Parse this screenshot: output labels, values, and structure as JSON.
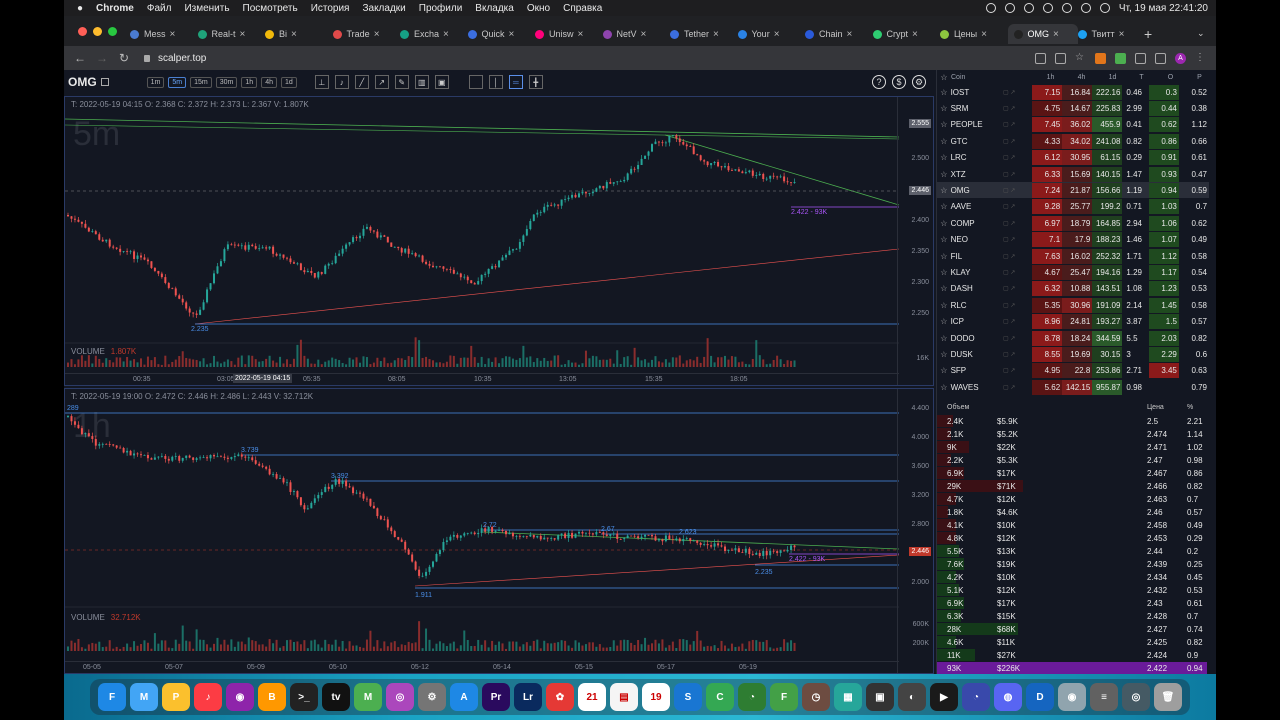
{
  "menubar": {
    "app": "Chrome",
    "items": [
      "Файл",
      "Изменить",
      "Посмотреть",
      "История",
      "Закладки",
      "Профили",
      "Вкладка",
      "Окно",
      "Справка"
    ],
    "clock": "Чт, 19 мая  22:41:20"
  },
  "tabs": [
    {
      "label": "Mess",
      "color": "#4a7bd0"
    },
    {
      "label": "Real-t",
      "color": "#1fa37a"
    },
    {
      "label": "Bi",
      "color": "#f0b90b"
    },
    {
      "label": "Trade",
      "color": "#e04a4a"
    },
    {
      "label": "Excha",
      "color": "#16a085"
    },
    {
      "label": "Quick",
      "color": "#3b6ee0"
    },
    {
      "label": "Unisw",
      "color": "#ff007a"
    },
    {
      "label": "NetV",
      "color": "#8e44ad"
    },
    {
      "label": "Tether",
      "color": "#3b6ee0"
    },
    {
      "label": "Your",
      "color": "#2a82e4"
    },
    {
      "label": "Chain",
      "color": "#2a5ada"
    },
    {
      "label": "Crypt",
      "color": "#2ecc71"
    },
    {
      "label": "Цены",
      "color": "#8dc63f"
    },
    {
      "label": "OMG",
      "color": "#222",
      "active": true
    },
    {
      "label": "Твитт",
      "color": "#1da1f2"
    }
  ],
  "address": {
    "url": "scalper.top"
  },
  "toolbar": {
    "symbol": "OMG",
    "timeframes": [
      "1m",
      "5m",
      "15m",
      "30m",
      "1h",
      "4h",
      "1d"
    ],
    "active_timeframe": "5m"
  },
  "chart_top": {
    "info": "T: 2022-05-19 04:15    O: 2.368    C: 2.372    H: 2.373    L: 2.367    V: 1.807K",
    "watermark": "5m",
    "volume_label": "VOLUME",
    "volume_value": "1.807K",
    "volume_axis": "16K",
    "price_ticks": [
      "2.500",
      "2.450",
      "2.400",
      "2.350",
      "2.300",
      "2.250"
    ],
    "last_price": "2.446",
    "top_tag": "2.555",
    "time_ticks": [
      "00:35",
      "03:05",
      "05:35",
      "08:05",
      "10:35",
      "13:05",
      "15:35",
      "18:05"
    ],
    "cursor_time": "2022-05-19 04:15",
    "levels": {
      "low": "2.235",
      "order": "2.422 - 93K"
    }
  },
  "chart_bottom": {
    "info": "T: 2022-05-19 19:00    O: 2.472    C: 2.446    H: 2.486    L: 2.443    V: 32.712K",
    "watermark": "1h",
    "volume_label": "VOLUME",
    "volume_value": "32.712K",
    "volume_ticks": [
      "600K",
      "200K"
    ],
    "price_ticks": [
      "4.400",
      "4.000",
      "3.600",
      "3.200",
      "2.800",
      "2.400",
      "2.000"
    ],
    "last_price": "2.446",
    "time_ticks": [
      "05-05",
      "05-07",
      "05-09",
      "05-10",
      "05-12",
      "05-14",
      "05-15",
      "05-17",
      "05-19"
    ],
    "levels": {
      "l289": "289",
      "l3739": "3.739",
      "l3392": "3.392",
      "l272": "2.72",
      "l267": "2.67",
      "l2623": "2.623",
      "l2235": "2.235",
      "l1911": "1.911",
      "order": "2.422 - 93K"
    }
  },
  "watchlist": {
    "headers": [
      "Coin",
      "1h",
      "4h",
      "1d",
      "T",
      "O",
      "P"
    ],
    "rows": [
      {
        "coin": "IOST",
        "h1": "7.15",
        "h4": "16.84",
        "d1": "222.16",
        "t": "0.46",
        "o": "0.3",
        "p": "0.52"
      },
      {
        "coin": "SRM",
        "h1": "4.75",
        "h4": "14.67",
        "d1": "225.83",
        "t": "2.99",
        "o": "0.44",
        "p": "0.38"
      },
      {
        "coin": "PEOPLE",
        "h1": "7.45",
        "h4": "36.02",
        "d1": "455.9",
        "t": "0.41",
        "o": "0.62",
        "p": "1.12"
      },
      {
        "coin": "GTC",
        "h1": "4.33",
        "h4": "34.02",
        "d1": "241.08",
        "t": "0.82",
        "o": "0.86",
        "p": "0.66"
      },
      {
        "coin": "LRC",
        "h1": "6.12",
        "h4": "30.95",
        "d1": "61.15",
        "t": "0.29",
        "o": "0.91",
        "p": "0.61"
      },
      {
        "coin": "XTZ",
        "h1": "6.33",
        "h4": "15.69",
        "d1": "140.15",
        "t": "1.47",
        "o": "0.93",
        "p": "0.47"
      },
      {
        "coin": "OMG",
        "h1": "7.24",
        "h4": "21.87",
        "d1": "156.66",
        "t": "1.19",
        "o": "0.94",
        "p": "0.59",
        "sel": true
      },
      {
        "coin": "AAVE",
        "h1": "9.28",
        "h4": "25.77",
        "d1": "199.2",
        "t": "0.71",
        "o": "1.03",
        "p": "0.7"
      },
      {
        "coin": "COMP",
        "h1": "6.97",
        "h4": "18.79",
        "d1": "164.85",
        "t": "2.94",
        "o": "1.06",
        "p": "0.62"
      },
      {
        "coin": "NEO",
        "h1": "7.1",
        "h4": "17.9",
        "d1": "188.23",
        "t": "1.46",
        "o": "1.07",
        "p": "0.49"
      },
      {
        "coin": "FIL",
        "h1": "7.63",
        "h4": "16.02",
        "d1": "252.32",
        "t": "1.71",
        "o": "1.12",
        "p": "0.58"
      },
      {
        "coin": "KLAY",
        "h1": "4.67",
        "h4": "25.47",
        "d1": "194.16",
        "t": "1.29",
        "o": "1.17",
        "p": "0.54"
      },
      {
        "coin": "DASH",
        "h1": "6.32",
        "h4": "10.88",
        "d1": "143.51",
        "t": "1.08",
        "o": "1.23",
        "p": "0.53"
      },
      {
        "coin": "RLC",
        "h1": "5.35",
        "h4": "30.96",
        "d1": "191.09",
        "t": "2.14",
        "o": "1.45",
        "p": "0.58"
      },
      {
        "coin": "ICP",
        "h1": "8.96",
        "h4": "24.81",
        "d1": "193.27",
        "t": "3.87",
        "o": "1.5",
        "p": "0.57"
      },
      {
        "coin": "DODO",
        "h1": "8.78",
        "h4": "18.24",
        "d1": "344.59",
        "t": "5.5",
        "o": "2.03",
        "p": "0.82"
      },
      {
        "coin": "DUSK",
        "h1": "8.55",
        "h4": "19.69",
        "d1": "30.15",
        "t": "3",
        "o": "2.29",
        "p": "0.6"
      },
      {
        "coin": "SFP",
        "h1": "4.95",
        "h4": "22.8",
        "d1": "253.86",
        "t": "2.71",
        "o": "3.45",
        "p": "0.63"
      },
      {
        "coin": "WAVES",
        "h1": "5.62",
        "h4": "142.15",
        "d1": "955.87",
        "t": "0.98",
        "o": "",
        "p": "0.79"
      }
    ]
  },
  "orderbook": {
    "headers": [
      "Объем",
      "Цена",
      "%"
    ],
    "rows": [
      {
        "v": "2.4K",
        "usd": "$5.9K",
        "price": "2.5",
        "pct": "2.21",
        "w": 0.06
      },
      {
        "v": "2.1K",
        "usd": "$5.2K",
        "price": "2.474",
        "pct": "1.14",
        "w": 0.05
      },
      {
        "v": "9K",
        "usd": "$22K",
        "price": "2.471",
        "pct": "1.02",
        "w": 0.12
      },
      {
        "v": "2.2K",
        "usd": "$5.3K",
        "price": "2.47",
        "pct": "0.98",
        "w": 0.05
      },
      {
        "v": "6.9K",
        "usd": "$17K",
        "price": "2.467",
        "pct": "0.86",
        "w": 0.1
      },
      {
        "v": "29K",
        "usd": "$71K",
        "price": "2.466",
        "pct": "0.82",
        "w": 0.32
      },
      {
        "v": "4.7K",
        "usd": "$12K",
        "price": "2.463",
        "pct": "0.7",
        "w": 0.07
      },
      {
        "v": "1.8K",
        "usd": "$4.6K",
        "price": "2.46",
        "pct": "0.57",
        "w": 0.04
      },
      {
        "v": "4.1K",
        "usd": "$10K",
        "price": "2.458",
        "pct": "0.49",
        "w": 0.07
      },
      {
        "v": "4.8K",
        "usd": "$12K",
        "price": "2.453",
        "pct": "0.29",
        "w": 0.07
      },
      {
        "v": "5.5K",
        "usd": "$13K",
        "price": "2.44",
        "pct": "0.2",
        "w": 0.08
      },
      {
        "v": "7.6K",
        "usd": "$19K",
        "price": "2.439",
        "pct": "0.25",
        "w": 0.1
      },
      {
        "v": "4.2K",
        "usd": "$10K",
        "price": "2.434",
        "pct": "0.45",
        "w": 0.07
      },
      {
        "v": "5.1K",
        "usd": "$12K",
        "price": "2.432",
        "pct": "0.53",
        "w": 0.08
      },
      {
        "v": "6.9K",
        "usd": "$17K",
        "price": "2.43",
        "pct": "0.61",
        "w": 0.1
      },
      {
        "v": "6.3K",
        "usd": "$15K",
        "price": "2.428",
        "pct": "0.7",
        "w": 0.09
      },
      {
        "v": "28K",
        "usd": "$68K",
        "price": "2.427",
        "pct": "0.74",
        "w": 0.3
      },
      {
        "v": "4.6K",
        "usd": "$11K",
        "price": "2.425",
        "pct": "0.82",
        "w": 0.07
      },
      {
        "v": "11K",
        "usd": "$27K",
        "price": "2.424",
        "pct": "0.9",
        "w": 0.14
      },
      {
        "v": "93K",
        "usd": "$226K",
        "price": "2.422",
        "pct": "0.94",
        "w": 1.0,
        "highlight": true
      }
    ]
  },
  "dock": [
    "F",
    "M",
    "P",
    "♪",
    "◉",
    "B",
    ">_",
    "tv",
    "M",
    "◎",
    "⚙",
    "A",
    "Pr",
    "Lr",
    "✿",
    "21",
    "▤",
    "19",
    "S",
    "C",
    "◔",
    "F",
    "◷",
    "▦",
    "▣",
    "◐",
    "▶",
    "◔",
    "◍",
    "D",
    "◉",
    "≡",
    "◎",
    "🗑"
  ]
}
